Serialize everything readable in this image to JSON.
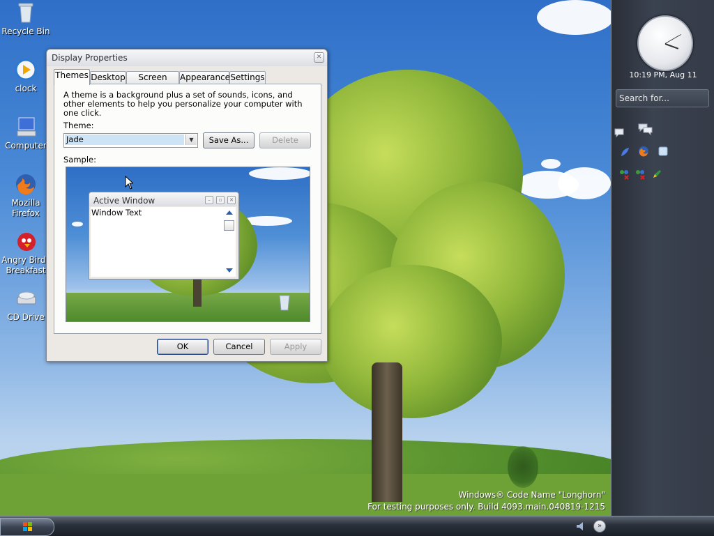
{
  "desktop_icons": [
    {
      "label": "Recycle Bin",
      "icon": "recycle-bin-icon"
    },
    {
      "label": "clock",
      "icon": "media-player-icon"
    },
    {
      "label": "Computer",
      "icon": "computer-icon"
    },
    {
      "label": "Mozilla Firefox",
      "icon": "firefox-icon"
    },
    {
      "label": "Angry Birds Breakfast",
      "icon": "angry-birds-icon"
    },
    {
      "label": "CD Drive",
      "icon": "cd-drive-icon"
    }
  ],
  "dialog": {
    "title": "Display Properties",
    "tabs": [
      "Themes",
      "Desktop",
      "Screen Saver",
      "Appearance",
      "Settings"
    ],
    "active_tab": "Themes",
    "intro": "A theme is a background plus a set of sounds, icons, and other elements to help you personalize your computer with one click.",
    "theme_label": "Theme:",
    "theme_value": "Jade",
    "save_as": "Save As...",
    "delete": "Delete",
    "sample_label": "Sample:",
    "sample": {
      "window_title": "Active Window",
      "window_text": "Window Text"
    },
    "ok": "OK",
    "cancel": "Cancel",
    "apply": "Apply"
  },
  "sidebar": {
    "time": "10:19 PM, Aug 11",
    "search_placeholder": "Search for..."
  },
  "watermark": {
    "line1": "Windows® Code Name \"Longhorn\"",
    "line2": "For testing purposes only. Build 4093.main.040819-1215"
  },
  "colors": {
    "accent": "#2c5fb0",
    "selection": "#cde4f7"
  }
}
